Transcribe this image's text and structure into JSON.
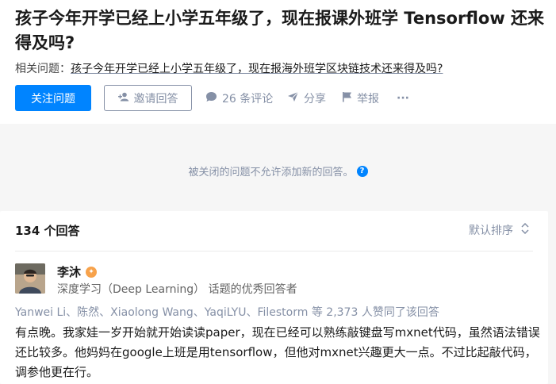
{
  "question": {
    "title": "孩子今年开学已经上小学五年级了，现在报课外班学 Tensorflow 还来得及吗?",
    "related_label": "相关问题：",
    "related_link": "孩子今年开学已经上小学五年级了，现在报海外班学区块链技术还来得及吗?"
  },
  "actions": {
    "follow": "关注问题",
    "invite": "邀请回答",
    "comments": "26 条评论",
    "share": "分享",
    "report": "举报",
    "more": "···"
  },
  "closed_notice": "被关闭的问题不允许添加新的回答。",
  "answers": {
    "count": "134 个回答",
    "sort": "默认排序"
  },
  "answer": {
    "author": "李沐",
    "description": "深度学习（Deep Learning） 话题的优秀回答者",
    "voters": "Yanwei Li、陈然、Xiaolong Wang、YaqiLYU、Filestorm 等 2,373 人赞同了该回答",
    "content": "有点晚。我家娃一岁开始就开始读读paper，现在已经可以熟练敲键盘写mxnet代码，虽然语法错误还比较多。他妈妈在google上班是用tensorflow，但他对mxnet兴趣更大一点。不过比起敲代码，调参他更在行。"
  },
  "colors": {
    "accent": "#0084ff",
    "muted": "#8590a6",
    "badge": "#f7a24b"
  },
  "icons": [
    "person-plus-icon",
    "comment-icon",
    "share-icon",
    "flag-icon",
    "more-icon",
    "help-icon",
    "sort-icon",
    "excellent-badge-icon"
  ]
}
